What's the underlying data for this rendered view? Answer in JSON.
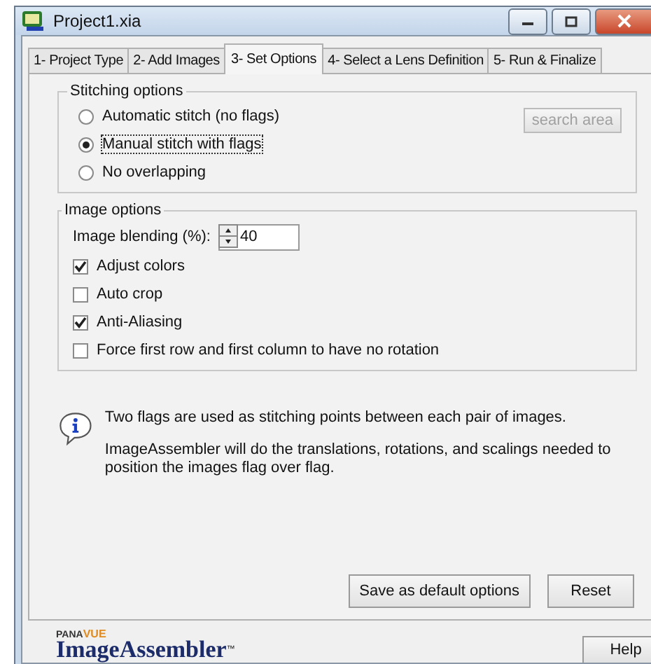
{
  "window": {
    "title": "Project1.xia"
  },
  "tabs": [
    {
      "label": "1- Project Type",
      "selected": false
    },
    {
      "label": "2- Add Images",
      "selected": false
    },
    {
      "label": "3- Set Options",
      "selected": true
    },
    {
      "label": "4- Select a Lens Definition",
      "selected": false
    },
    {
      "label": "5- Run & Finalize",
      "selected": false
    }
  ],
  "stitching_options": {
    "title": "Stitching options",
    "search_button": {
      "label": "search area",
      "disabled": true
    },
    "radios": [
      {
        "label": "Automatic stitch (no flags)",
        "selected": false
      },
      {
        "label": "Manual stitch with flags",
        "selected": true
      },
      {
        "label": "No overlapping",
        "selected": false
      }
    ]
  },
  "image_options": {
    "title": "Image options",
    "blending": {
      "label": "Image blending (%):",
      "value": "40"
    },
    "checkboxes": [
      {
        "label": "Adjust colors",
        "checked": true
      },
      {
        "label": "Auto crop",
        "checked": false
      },
      {
        "label": "Anti-Aliasing",
        "checked": true
      },
      {
        "label": "Force first row and first column to have no rotation",
        "checked": false
      }
    ]
  },
  "info": [
    "Two flags are used as stitching points between each pair of images.",
    "ImageAssembler will do the translations, rotations, and scalings needed to position the images flag over flag."
  ],
  "buttons": [
    "Save as default options",
    "Reset"
  ],
  "footer": {
    "logo": {
      "brand_left": "PANA",
      "brand_right": "VUE",
      "product": "ImageAssembler",
      "mark": "™"
    },
    "help": "Help"
  }
}
